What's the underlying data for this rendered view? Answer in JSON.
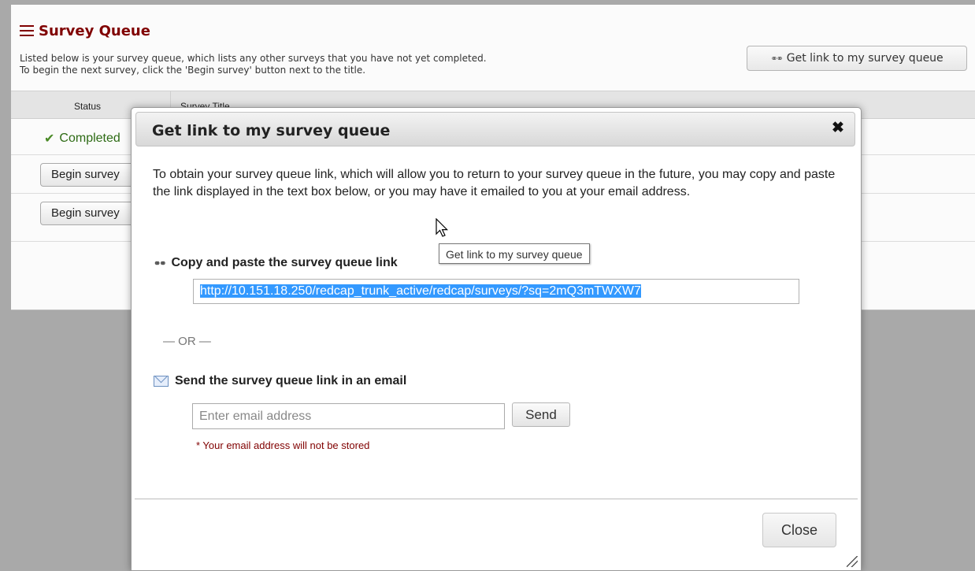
{
  "page": {
    "title": "Survey Queue",
    "description_line1": "Listed below is your survey queue, which lists any other surveys that you have not yet completed.",
    "description_line2": "To begin the next survey, click the 'Begin survey' button next to the title.",
    "get_link_button": "Get link to my survey queue",
    "table": {
      "columns": [
        "Status",
        "Survey Title"
      ],
      "rows": [
        {
          "status": "Completed"
        },
        {
          "button": "Begin survey"
        },
        {
          "button": "Begin survey"
        }
      ]
    }
  },
  "dialog": {
    "title": "Get link to my survey queue",
    "intro": "To obtain your survey queue link, which will allow you to return to your survey queue in the future, you may copy and paste the link displayed in the text box below, or you may have it emailed to you at your email address.",
    "copy_label": "Copy and paste the survey queue link",
    "url": "http://10.151.18.250/redcap_trunk_active/redcap/surveys/?sq=2mQ3mTWXW7",
    "or_text": "— OR —",
    "email_label": "Send the survey queue link in an email",
    "email_placeholder": "Enter email address",
    "send_button": "Send",
    "note": "* Your email address will not be stored",
    "close_button": "Close"
  },
  "tooltip": "Get link to my survey queue",
  "colors": {
    "title_red": "#800000",
    "selection_blue": "#3399ff",
    "completed_green": "#2e6b15"
  }
}
